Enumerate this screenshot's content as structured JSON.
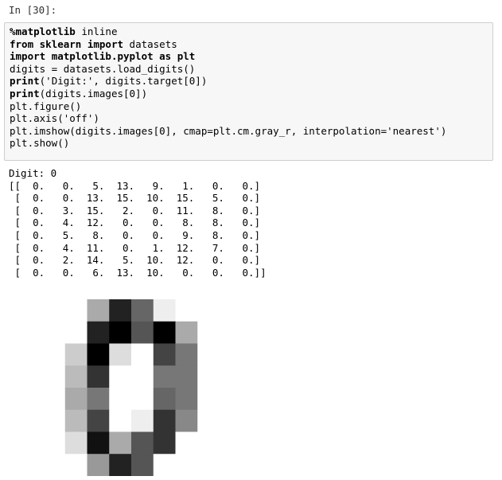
{
  "prompt": "In [30]:",
  "code_lines": [
    [
      {
        "t": "%matplotlib",
        "kw": true
      },
      {
        "t": " inline",
        "kw": false
      }
    ],
    [
      {
        "t": "from",
        "kw": true
      },
      {
        "t": " ",
        "kw": false
      },
      {
        "t": "sklearn",
        "kw": true
      },
      {
        "t": " ",
        "kw": false
      },
      {
        "t": "import",
        "kw": true
      },
      {
        "t": " datasets",
        "kw": false
      }
    ],
    [
      {
        "t": "import",
        "kw": true
      },
      {
        "t": " ",
        "kw": false
      },
      {
        "t": "matplotlib.pyplot",
        "kw": true
      },
      {
        "t": " ",
        "kw": false
      },
      {
        "t": "as",
        "kw": true
      },
      {
        "t": " ",
        "kw": false
      },
      {
        "t": "plt",
        "kw": true
      }
    ],
    [
      {
        "t": "digits = datasets.load_digits()",
        "kw": false
      }
    ],
    [
      {
        "t": "print",
        "kw": true
      },
      {
        "t": "('Digit:', digits.target[0])",
        "kw": false
      }
    ],
    [
      {
        "t": "print",
        "kw": true
      },
      {
        "t": "(digits.images[0])",
        "kw": false
      }
    ],
    [
      {
        "t": "plt.figure()",
        "kw": false
      }
    ],
    [
      {
        "t": "plt.axis('off')",
        "kw": false
      }
    ],
    [
      {
        "t": "plt.imshow(digits.images[0], cmap=plt.cm.gray_r, interpolation='nearest')",
        "kw": false
      }
    ],
    [
      {
        "t": "plt.show()",
        "kw": false
      }
    ]
  ],
  "output_lines": [
    "Digit: 0",
    "[[  0.   0.   5.  13.   9.   1.   0.   0.]",
    " [  0.   0.  13.  15.  10.  15.   5.   0.]",
    " [  0.   3.  15.   2.   0.  11.   8.   0.]",
    " [  0.   4.  12.   0.   0.   8.   8.   0.]",
    " [  0.   5.   8.   0.   0.   9.   8.   0.]",
    " [  0.   4.  11.   0.   1.  12.   7.   0.]",
    " [  0.   2.  14.   5.  10.  12.   0.   0.]",
    " [  0.   0.   6.  13.  10.   0.   0.   0.]]"
  ],
  "image": {
    "colormap": "gray_r",
    "vmax": 15,
    "pixels": [
      [
        0,
        0,
        5,
        13,
        9,
        1,
        0,
        0
      ],
      [
        0,
        0,
        13,
        15,
        10,
        15,
        5,
        0
      ],
      [
        0,
        3,
        15,
        2,
        0,
        11,
        8,
        0
      ],
      [
        0,
        4,
        12,
        0,
        0,
        8,
        8,
        0
      ],
      [
        0,
        5,
        8,
        0,
        0,
        9,
        8,
        0
      ],
      [
        0,
        4,
        11,
        0,
        1,
        12,
        7,
        0
      ],
      [
        0,
        2,
        14,
        5,
        10,
        12,
        0,
        0
      ],
      [
        0,
        0,
        6,
        13,
        10,
        0,
        0,
        0
      ]
    ]
  }
}
